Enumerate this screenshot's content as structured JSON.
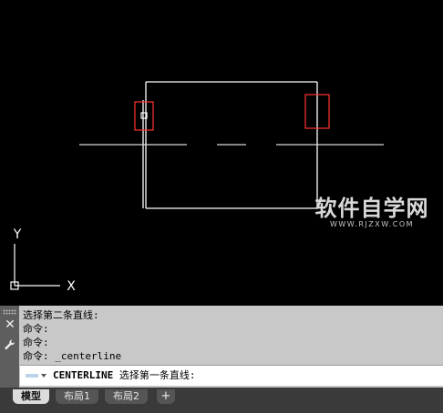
{
  "colors": {
    "canvas_bg": "#000000",
    "geometry": "#ffffff",
    "selection_box": "#ff3333",
    "command_bg": "#c8c8c8",
    "tabbar_bg": "#3a3a3a"
  },
  "viewport": {
    "ucs_x_label": "X",
    "ucs_y_label": "Y",
    "watermark_main": "软件自学网",
    "watermark_sub": "WWW.RJZXW.COM"
  },
  "command_line": {
    "history": [
      "选择第二条直线:",
      "命令:",
      "命令:",
      "命令: _centerline"
    ],
    "prompt_command": "CENTERLINE",
    "prompt_text": " 选择第一条直线:",
    "close_icon": "close-icon",
    "settings_icon": "wrench-icon"
  },
  "tabs": [
    {
      "label": "模型",
      "active": true
    },
    {
      "label": "布局1",
      "active": false
    },
    {
      "label": "布局2",
      "active": false
    }
  ],
  "add_tab_label": "+"
}
